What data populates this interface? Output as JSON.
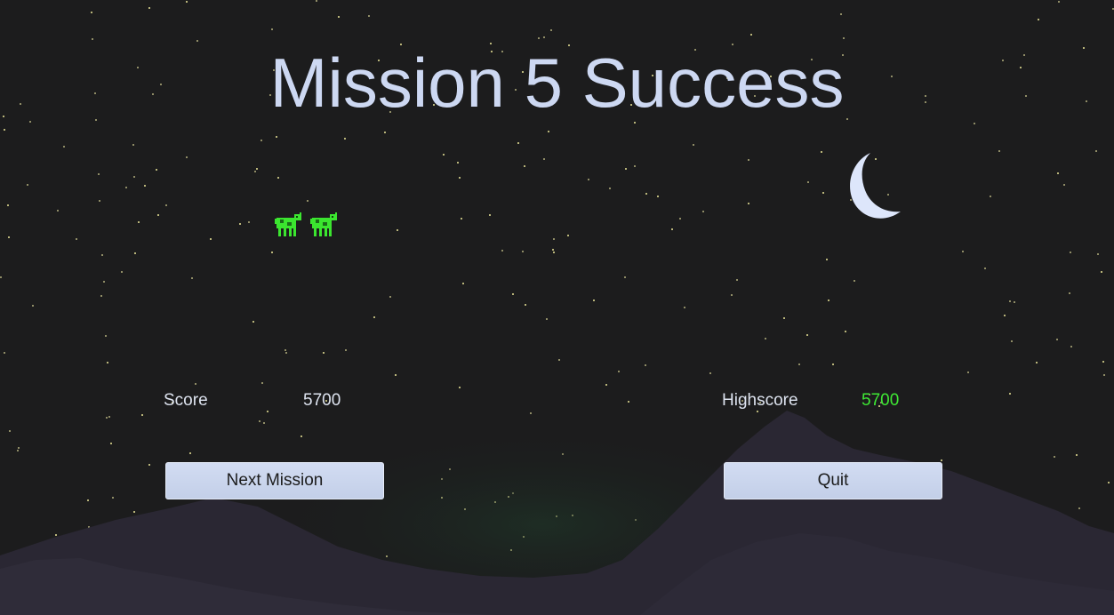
{
  "title": "Mission 5 Success",
  "score": {
    "label": "Score",
    "value": "5700"
  },
  "highscore": {
    "label": "Highscore",
    "value": "5700",
    "color": "#3ee834"
  },
  "buttons": {
    "next_mission": "Next Mission",
    "quit": "Quit"
  },
  "lives": {
    "icon": "cow-icon",
    "count": 2,
    "color": "#3be52f"
  },
  "colors": {
    "background": "#1c1c1d",
    "title": "#cdd8f2",
    "button": "#cbd6ee",
    "moon": "#dde6fb",
    "mountains": "#2a2733",
    "stars": "#b9b57a"
  }
}
